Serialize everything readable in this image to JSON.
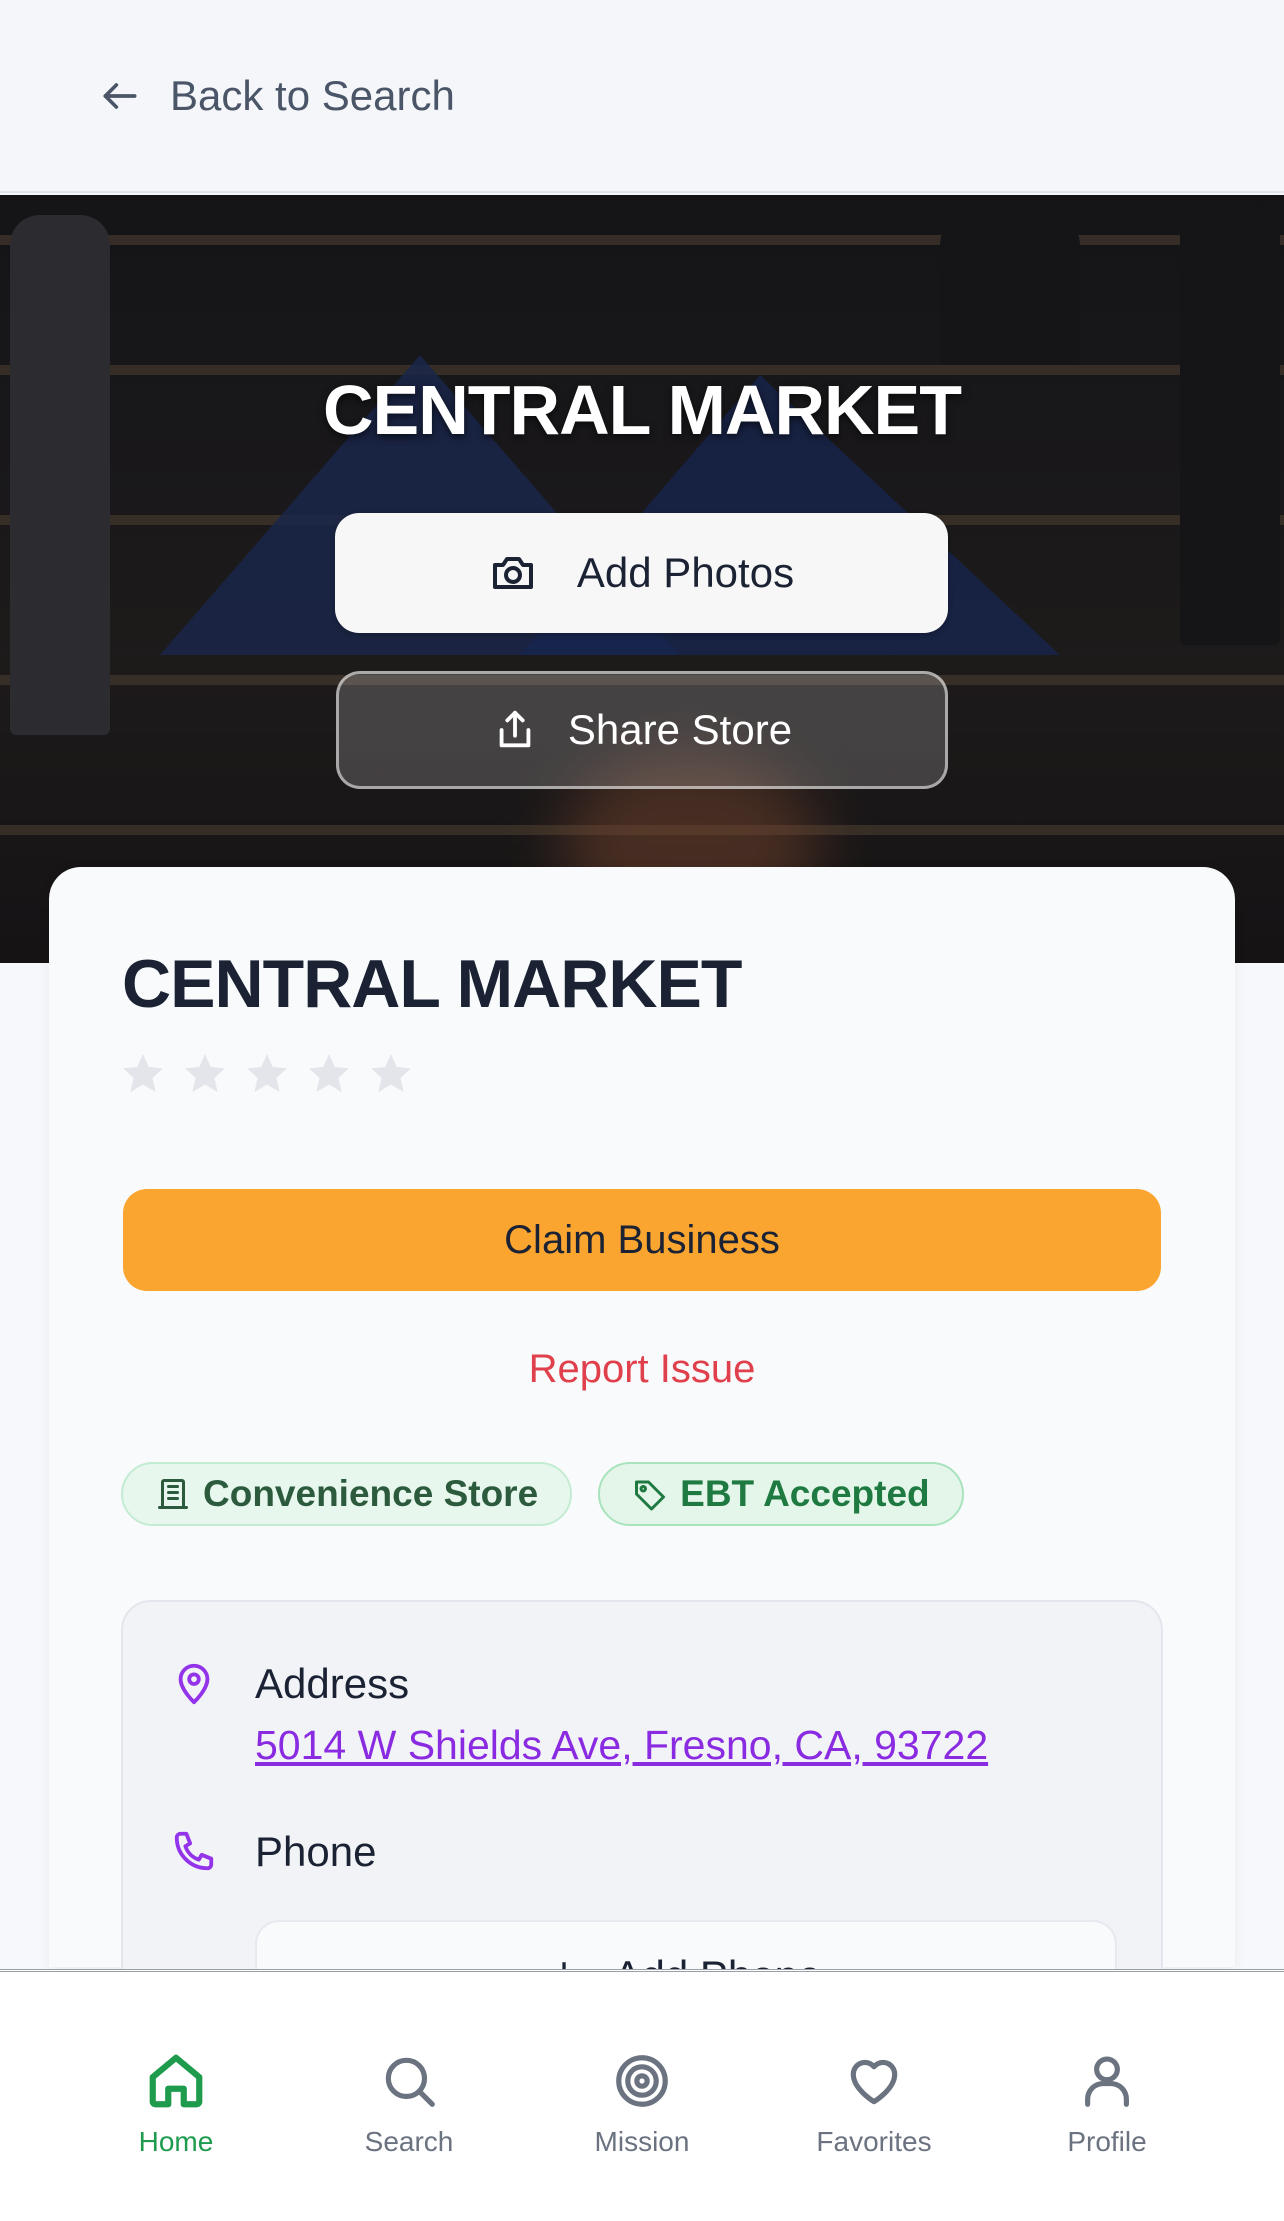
{
  "topbar": {
    "back_label": "Back to Search"
  },
  "hero": {
    "title": "CENTRAL MARKET",
    "add_photos_label": "Add Photos",
    "share_label": "Share Store"
  },
  "store": {
    "name": "CENTRAL MARKET",
    "rating": 0,
    "rating_max": 5,
    "claim_label": "Claim Business",
    "report_label": "Report Issue",
    "tags": [
      {
        "label": "Convenience Store",
        "icon": "building-icon"
      },
      {
        "label": "EBT Accepted",
        "icon": "tag-icon"
      }
    ]
  },
  "info": {
    "address_label": "Address",
    "address_value": "5014 W Shields Ave, Fresno, CA, 93722",
    "phone_label": "Phone",
    "add_phone_label": "Add Phone"
  },
  "nav": {
    "items": [
      {
        "label": "Home",
        "icon": "home-icon",
        "active": true
      },
      {
        "label": "Search",
        "icon": "search-icon",
        "active": false
      },
      {
        "label": "Mission",
        "icon": "target-icon",
        "active": false
      },
      {
        "label": "Favorites",
        "icon": "heart-icon",
        "active": false
      },
      {
        "label": "Profile",
        "icon": "user-icon",
        "active": false
      }
    ]
  },
  "colors": {
    "accent_green": "#1f9b4e",
    "claim_orange": "#fba531",
    "report_red": "#e0404b",
    "link_purple": "#8a2be2"
  }
}
